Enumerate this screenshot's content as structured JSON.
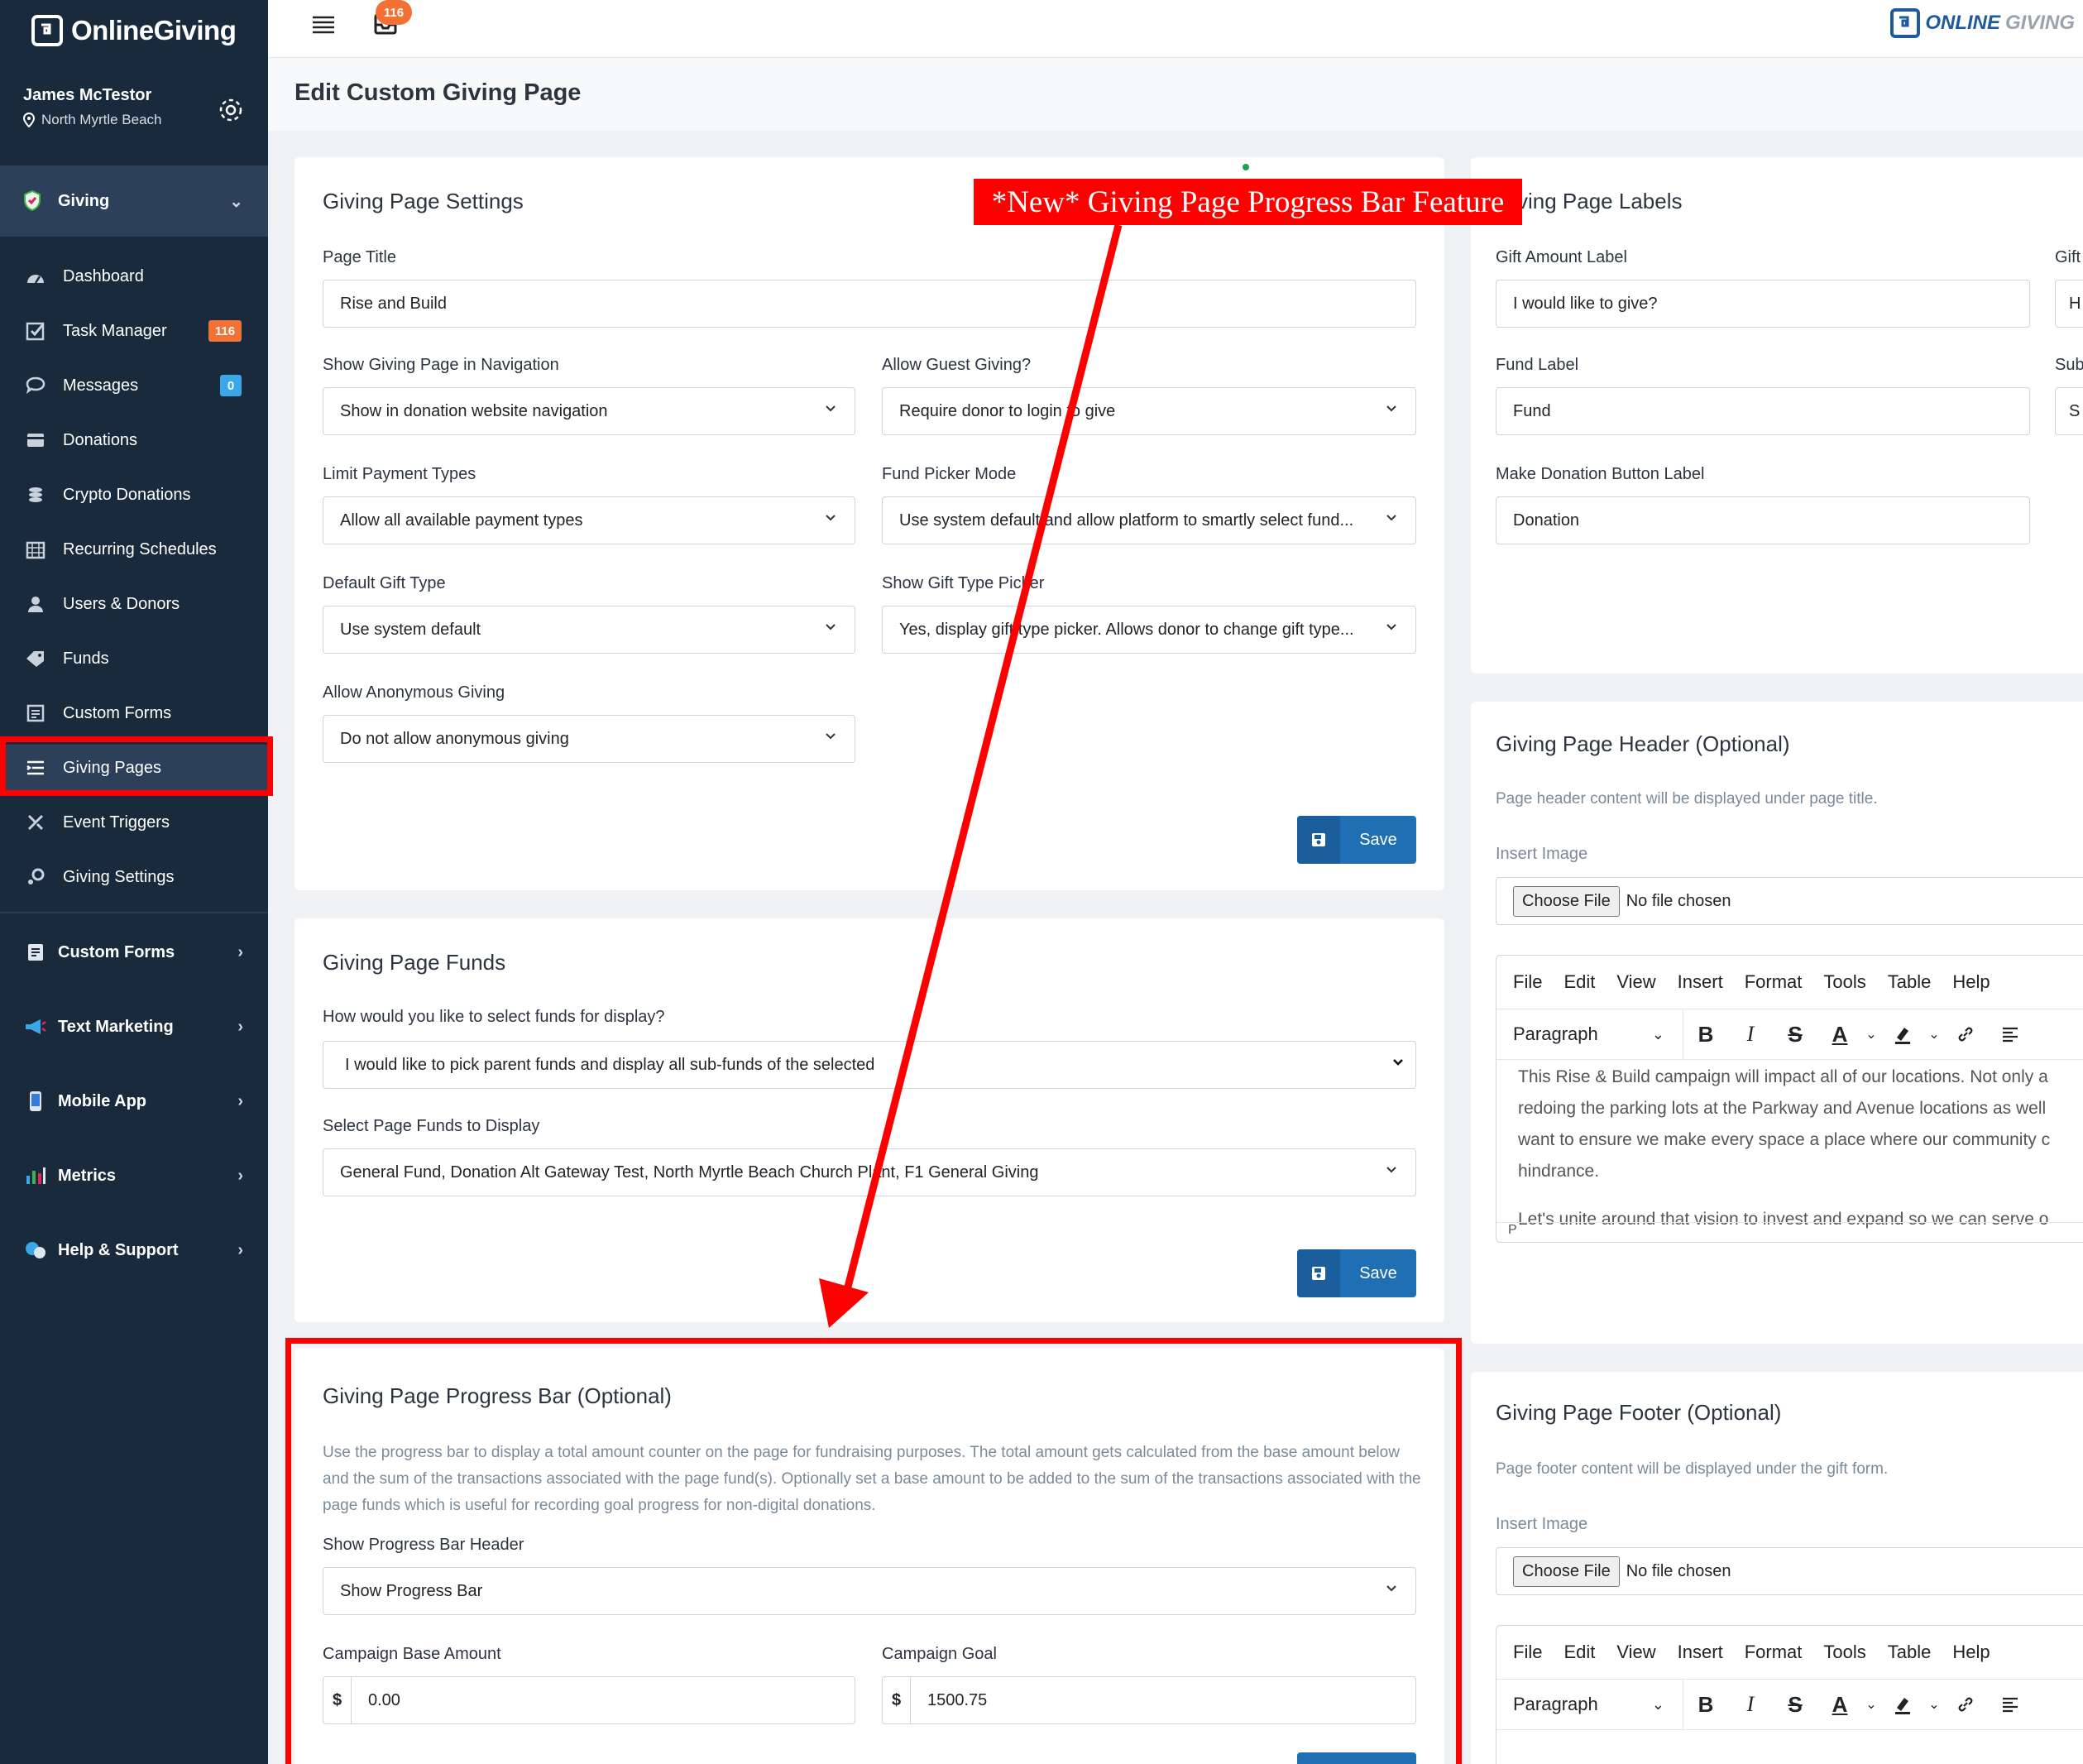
{
  "brand": {
    "name": "OnlineGiving",
    "top_logo_a": "ONLINE",
    "top_logo_b": "GIVING"
  },
  "user": {
    "name": "James McTestor",
    "location": "North Myrtle Beach"
  },
  "topbar": {
    "inbox_count": "116"
  },
  "sidebar": {
    "giving_section": "Giving",
    "items": [
      {
        "label": "Dashboard",
        "icon": "dashboard-icon"
      },
      {
        "label": "Task Manager",
        "icon": "task-icon",
        "badge": "116"
      },
      {
        "label": "Messages",
        "icon": "chat-icon",
        "badge": "0"
      },
      {
        "label": "Donations",
        "icon": "donations-icon"
      },
      {
        "label": "Crypto Donations",
        "icon": "coins-icon"
      },
      {
        "label": "Recurring Schedules",
        "icon": "calendar-icon"
      },
      {
        "label": "Users & Donors",
        "icon": "user-icon"
      },
      {
        "label": "Funds",
        "icon": "tag-icon"
      },
      {
        "label": "Custom Forms",
        "icon": "forms-icon"
      },
      {
        "label": "Giving Pages",
        "icon": "list-icon"
      },
      {
        "label": "Event Triggers",
        "icon": "trigger-icon"
      },
      {
        "label": "Giving Settings",
        "icon": "settings-icon"
      }
    ],
    "sections": [
      {
        "label": "Custom Forms"
      },
      {
        "label": "Text Marketing"
      },
      {
        "label": "Mobile App"
      },
      {
        "label": "Metrics"
      },
      {
        "label": "Help & Support"
      }
    ]
  },
  "page": {
    "title": "Edit Custom Giving Page"
  },
  "annotation": {
    "callout": "*New* Giving Page Progress Bar Feature"
  },
  "settings": {
    "title": "Giving Page Settings",
    "page_title_label": "Page Title",
    "page_title_value": "Rise and Build",
    "nav_label": "Show Giving Page in Navigation",
    "nav_value": "Show in donation website navigation",
    "guest_label": "Allow Guest Giving?",
    "guest_value": "Require donor to login to give",
    "payment_label": "Limit Payment Types",
    "payment_value": "Allow all available payment types",
    "fund_picker_label": "Fund Picker Mode",
    "fund_picker_value": "Use system default and allow platform to smartly select fund...",
    "gift_type_label": "Default Gift Type",
    "gift_type_value": "Use system default",
    "gift_picker_label": "Show Gift Type Picker",
    "gift_picker_value": "Yes, display gift type picker. Allows donor to change gift type...",
    "anon_label": "Allow Anonymous Giving",
    "anon_value": "Do not allow anonymous giving",
    "save": "Save"
  },
  "funds": {
    "title": "Giving Page Funds",
    "select_label": "How would you like to select funds for display?",
    "select_value": "I would like to pick parent funds and display all sub-funds of the selected",
    "display_label": "Select Page Funds to Display",
    "display_value": "General Fund, Donation Alt Gateway Test, North Myrtle Beach Church Plant, F1 General Giving",
    "save": "Save"
  },
  "progress": {
    "title": "Giving Page Progress Bar (Optional)",
    "help": "Use the progress bar to display a total amount counter on the page for fundraising purposes. The total amount gets calculated from the base amount below and the sum of the transactions associated with the page fund(s). Optionally set a base amount to be added to the sum of the transactions associated with the page funds which is useful for recording goal progress for non-digital donations.",
    "header_label": "Show Progress Bar Header",
    "header_value": "Show Progress Bar",
    "base_label": "Campaign Base Amount",
    "base_value": "0.00",
    "goal_label": "Campaign Goal",
    "goal_value": "1500.75",
    "currency": "$"
  },
  "labels": {
    "title": "Giving Page Labels",
    "gift_amount_label": "Gift Amount Label",
    "gift_amount_value": "I would like to give?",
    "fund_label": "Fund Label",
    "fund_value": "Fund",
    "button_label": "Make Donation Button Label",
    "button_value": "Donation",
    "clipped_a": "Gift",
    "clipped_a_val": "H",
    "clipped_b": "Sub",
    "clipped_b_val": "S"
  },
  "header_card": {
    "title": "Giving Page Header (Optional)",
    "help": "Page header content will be displayed under page title.",
    "insert_label": "Insert Image",
    "choose_file": "Choose File",
    "no_file": "No file chosen",
    "menus": [
      "File",
      "Edit",
      "View",
      "Insert",
      "Format",
      "Tools",
      "Table",
      "Help"
    ],
    "paragraph": "Paragraph",
    "body_lines": [
      "This Rise & Build campaign will impact all of our locations. Not only a",
      "redoing the parking lots at the Parkway and Avenue locations as well",
      "want to ensure we make every space a place where our community c",
      "hindrance.",
      "",
      "Let's unite around that vision to invest and expand so we can serve o"
    ],
    "status": "P"
  },
  "footer_card": {
    "title": "Giving Page Footer (Optional)",
    "help": "Page footer content will be displayed under the gift form.",
    "insert_label": "Insert Image",
    "choose_file": "Choose File",
    "no_file": "No file chosen",
    "menus": [
      "File",
      "Edit",
      "View",
      "Insert",
      "Format",
      "Tools",
      "Table",
      "Help"
    ],
    "paragraph": "Paragraph"
  },
  "colors": {
    "sidebar": "#1a2a3d",
    "accent": "#1f6fb4",
    "highlight": "#ff0000",
    "badge": "#f37135"
  }
}
